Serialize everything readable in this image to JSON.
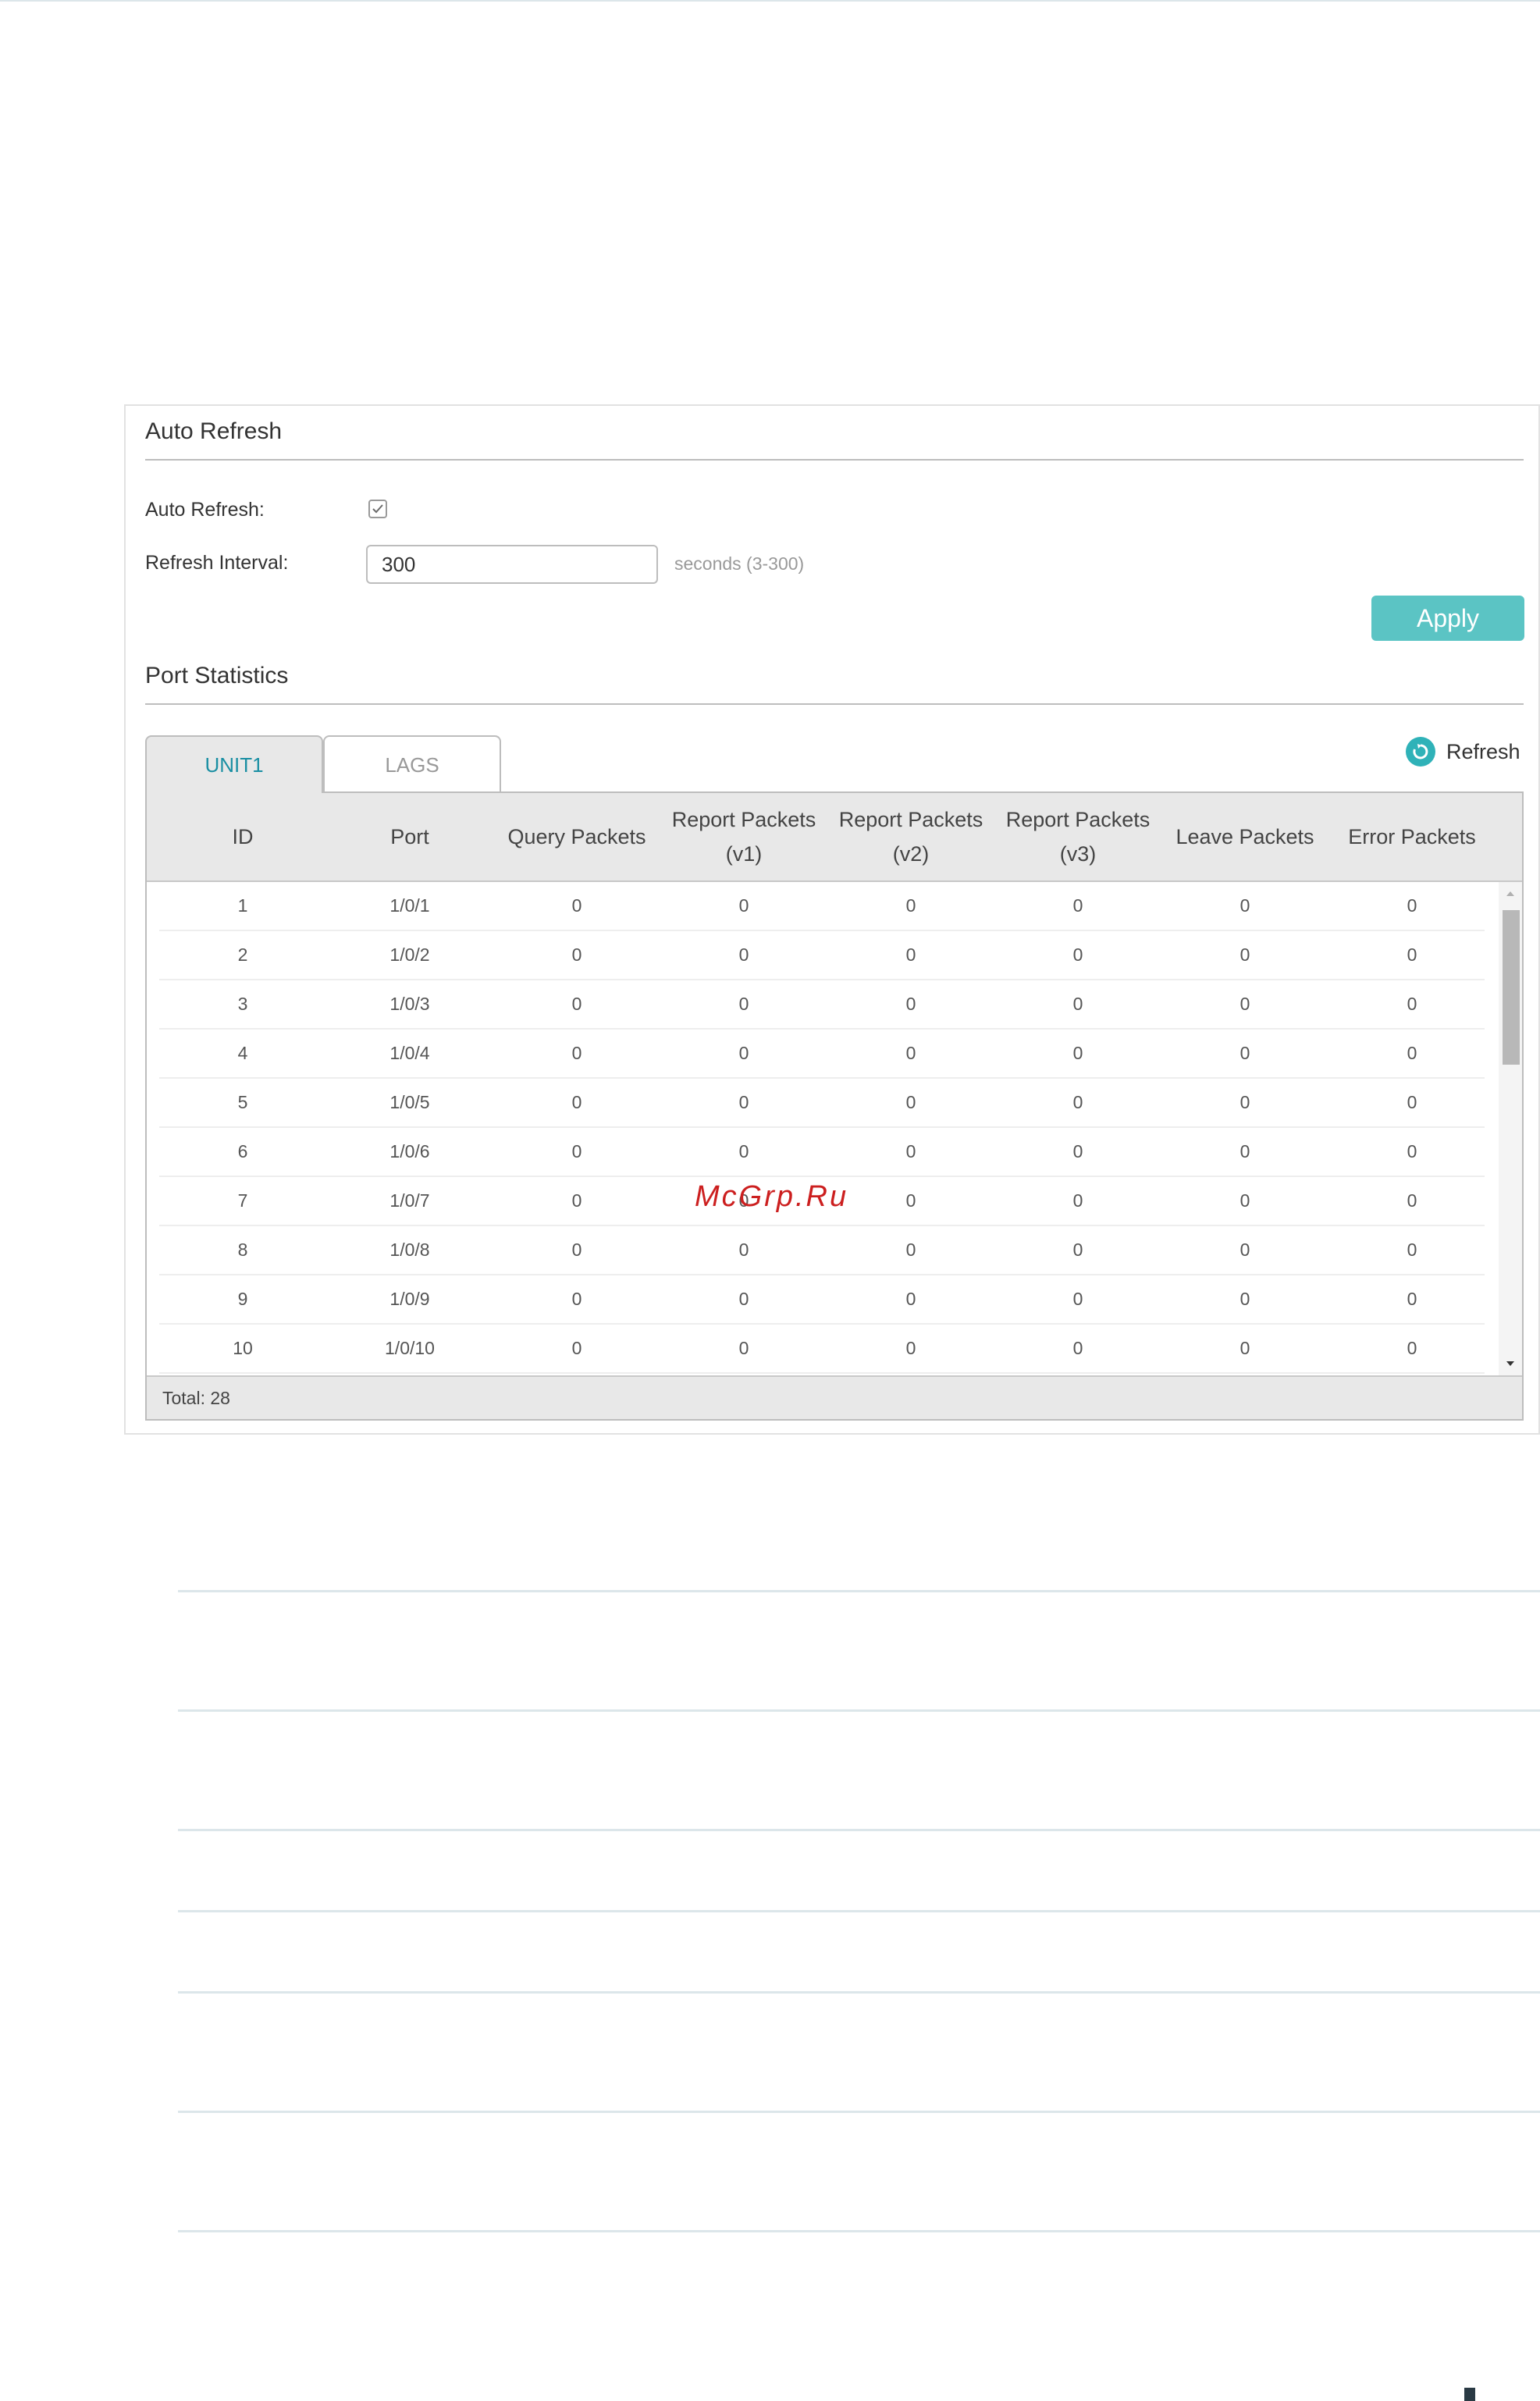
{
  "auto_refresh": {
    "section_title": "Auto Refresh",
    "auto_refresh_label": "Auto Refresh:",
    "auto_refresh_checked": true,
    "interval_label": "Refresh Interval:",
    "interval_value": "300",
    "interval_hint": "seconds (3-300)",
    "apply_label": "Apply"
  },
  "port_statistics": {
    "section_title": "Port Statistics",
    "tabs": [
      {
        "label": "UNIT1",
        "active": true
      },
      {
        "label": "LAGS",
        "active": false
      }
    ],
    "refresh_label": "Refresh",
    "columns": [
      "ID",
      "Port",
      "Query Packets",
      "Report Packets\n(v1)",
      "Report Packets\n(v2)",
      "Report Packets\n(v3)",
      "Leave Packets",
      "Error Packets"
    ],
    "rows": [
      [
        "1",
        "1/0/1",
        "0",
        "0",
        "0",
        "0",
        "0",
        "0"
      ],
      [
        "2",
        "1/0/2",
        "0",
        "0",
        "0",
        "0",
        "0",
        "0"
      ],
      [
        "3",
        "1/0/3",
        "0",
        "0",
        "0",
        "0",
        "0",
        "0"
      ],
      [
        "4",
        "1/0/4",
        "0",
        "0",
        "0",
        "0",
        "0",
        "0"
      ],
      [
        "5",
        "1/0/5",
        "0",
        "0",
        "0",
        "0",
        "0",
        "0"
      ],
      [
        "6",
        "1/0/6",
        "0",
        "0",
        "0",
        "0",
        "0",
        "0"
      ],
      [
        "7",
        "1/0/7",
        "0",
        "0",
        "0",
        "0",
        "0",
        "0"
      ],
      [
        "8",
        "1/0/8",
        "0",
        "0",
        "0",
        "0",
        "0",
        "0"
      ],
      [
        "9",
        "1/0/9",
        "0",
        "0",
        "0",
        "0",
        "0",
        "0"
      ],
      [
        "10",
        "1/0/10",
        "0",
        "0",
        "0",
        "0",
        "0",
        "0"
      ]
    ],
    "total_label": "Total: 28"
  },
  "watermark": "McGrp.Ru",
  "colors": {
    "accent": "#5bc4c4",
    "tab_active_text": "#1a8fa3",
    "refresh_icon": "#2fb2b8",
    "header_bg": "#e8e8e8"
  },
  "icons": {
    "checkbox": "check-icon",
    "refresh": "refresh-circle-icon",
    "scroll_up": "triangle-up-icon",
    "scroll_down": "triangle-down-icon"
  }
}
